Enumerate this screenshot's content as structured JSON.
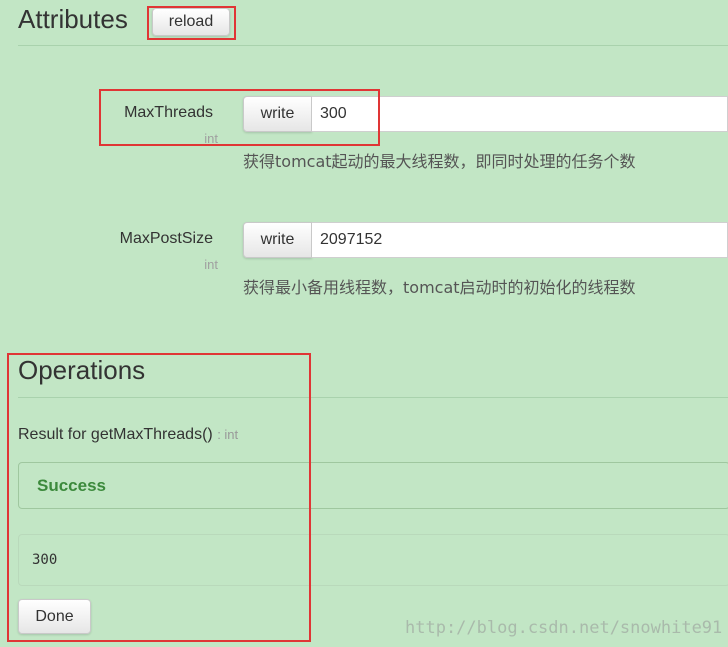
{
  "attributes": {
    "heading": "Attributes",
    "reload_label": "reload",
    "items": [
      {
        "name": "MaxThreads",
        "type": "int",
        "write_label": "write",
        "value": "300",
        "description": "获得tomcat起动的最大线程数，即同时处理的任务个数"
      },
      {
        "name": "MaxPostSize",
        "type": "int",
        "write_label": "write",
        "value": "2097152",
        "description": "获得最小备用线程数，tomcat启动时的初始化的线程数"
      }
    ]
  },
  "operations": {
    "heading": "Operations",
    "result_label": "Result for getMaxThreads()",
    "result_type": ": int",
    "status": "Success",
    "result_value": "300",
    "done_label": "Done"
  },
  "watermark": "http://blog.csdn.net/snowhite91",
  "colors": {
    "background": "#c2e6c5",
    "success_text": "#3c8a3c",
    "highlight": "#e03535"
  }
}
